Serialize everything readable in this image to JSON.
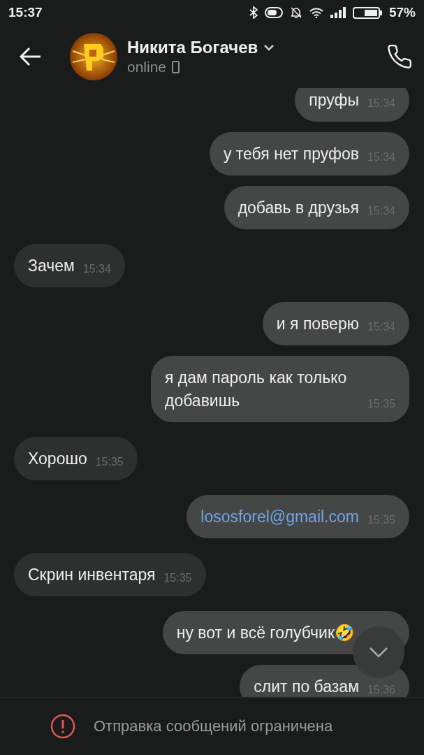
{
  "status_bar": {
    "time": "15:37",
    "battery": "57%"
  },
  "header": {
    "name": "Никита Богачев",
    "status": "online"
  },
  "messages": [
    {
      "text": "пруфы",
      "time": "15:34",
      "outgoing": true,
      "kind": "text"
    },
    {
      "text": "у тебя нет пруфов",
      "time": "15:34",
      "outgoing": true,
      "kind": "text"
    },
    {
      "text": "добавь в друзья",
      "time": "15:34",
      "outgoing": true,
      "kind": "text"
    },
    {
      "text": "Зачем",
      "time": "15:34",
      "outgoing": false,
      "kind": "text"
    },
    {
      "text": "и я поверю",
      "time": "15:34",
      "outgoing": true,
      "kind": "text"
    },
    {
      "text": "я дам пароль как только добавишь",
      "time": "15:35",
      "outgoing": true,
      "kind": "text"
    },
    {
      "text": "Хорошо",
      "time": "15:35",
      "outgoing": false,
      "kind": "text"
    },
    {
      "text": "lososforel@gmail.com",
      "time": "15:35",
      "outgoing": true,
      "kind": "link"
    },
    {
      "text": "Скрин инвентаря",
      "time": "15:35",
      "outgoing": false,
      "kind": "text"
    },
    {
      "text": "ну вот и всё голубчик🤣",
      "outgoing": true,
      "kind": "text"
    },
    {
      "text": "слит по базам",
      "time": "15:36",
      "outgoing": true,
      "kind": "text"
    }
  ],
  "footer": {
    "notice": "Отправка сообщений ограничена"
  }
}
